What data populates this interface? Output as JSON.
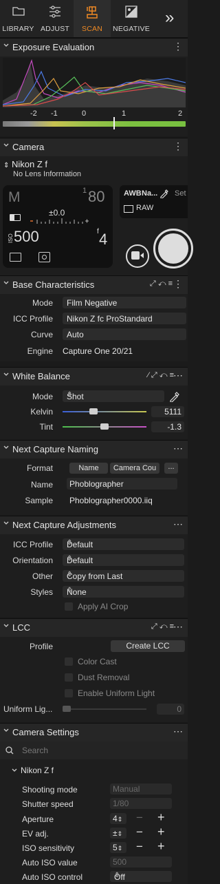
{
  "tabs": [
    {
      "label": "LIBRARY",
      "icon": "folder-icon"
    },
    {
      "label": "ADJUST",
      "icon": "sliders-icon"
    },
    {
      "label": "SCAN",
      "icon": "scan-camera-icon"
    },
    {
      "label": "NEGATIVE",
      "icon": "negative-icon"
    }
  ],
  "more_tabs": "»",
  "exposure": {
    "title": "Exposure Evaluation",
    "scale": [
      "-2",
      "-1",
      "0",
      "1",
      "2"
    ]
  },
  "camera": {
    "title": "Camera",
    "model": "Nikon Z f",
    "lens": "No Lens Information",
    "mode": "M",
    "shutter_num": "1",
    "shutter_den": "80",
    "ev": "±0.0",
    "iso_label": "ISO",
    "iso": "500",
    "aperture_f": "f",
    "aperture": "4",
    "wb_label": "Na...",
    "set_label": "Set",
    "format": "RAW"
  },
  "base": {
    "title": "Base Characteristics",
    "rows": [
      {
        "label": "Mode",
        "value": "Film Negative"
      },
      {
        "label": "ICC Profile",
        "value": "Nikon Z fc ProStandard"
      },
      {
        "label": "Curve",
        "value": "Auto"
      },
      {
        "label": "Engine",
        "value": "Capture One 20/21"
      }
    ]
  },
  "wb": {
    "title": "White Balance",
    "mode_label": "Mode",
    "mode": "Shot",
    "kelvin_label": "Kelvin",
    "kelvin": "5111",
    "tint_label": "Tint",
    "tint": "-1.3",
    "kelvin_pos": 0.35,
    "tint_pos": 0.5
  },
  "naming": {
    "title": "Next Capture Naming",
    "format_label": "Format",
    "token1": "Name",
    "token2": "Camera Cou",
    "more": "...",
    "name_label": "Name",
    "name": "Phoblographer",
    "sample_label": "Sample",
    "sample": "Phoblographer0000.iiq"
  },
  "adjust": {
    "title": "Next Capture Adjustments",
    "rows": [
      {
        "label": "ICC Profile",
        "value": "Default"
      },
      {
        "label": "Orientation",
        "value": "Default"
      },
      {
        "label": "Other",
        "value": "Copy from Last"
      },
      {
        "label": "Styles",
        "value": "None"
      }
    ],
    "ai_crop": "Apply AI Crop"
  },
  "lcc": {
    "title": "LCC",
    "profile_label": "Profile",
    "create_btn": "Create LCC",
    "color_cast": "Color Cast",
    "dust": "Dust Removal",
    "uniform_light": "Enable Uniform Light",
    "uniform_label": "Uniform Lig...",
    "uniform_value": "0"
  },
  "settings": {
    "title": "Camera Settings",
    "search_placeholder": "Search",
    "group": "Nikon Z f",
    "rows": [
      {
        "label": "Shooting mode",
        "value": "Manual"
      },
      {
        "label": "Shutter speed",
        "value": "1/80"
      },
      {
        "label": "Aperture",
        "value": "4"
      },
      {
        "label": "EV adj.",
        "value": "±"
      },
      {
        "label": "ISO sensitivity",
        "value": "5"
      },
      {
        "label": "Auto ISO value",
        "value": "500"
      },
      {
        "label": "Auto ISO control",
        "value": "Off"
      }
    ],
    "minus": "−",
    "plus": "+"
  }
}
